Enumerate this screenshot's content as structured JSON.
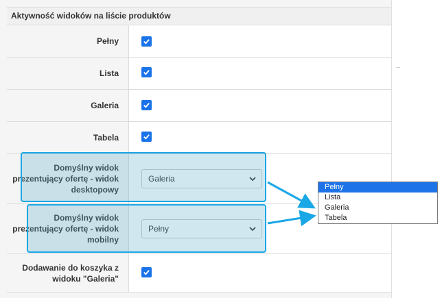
{
  "section": {
    "title": "Aktywność widoków na liście produktów"
  },
  "rows": [
    {
      "label": "Pełny",
      "checked": true
    },
    {
      "label": "Lista",
      "checked": true
    },
    {
      "label": "Galeria",
      "checked": true
    },
    {
      "label": "Tabela",
      "checked": true
    },
    {
      "label": "Domyślny widok prezentujący ofertę - widok desktopowy",
      "select_value": "Galeria"
    },
    {
      "label": "Domyślny widok prezentujący ofertę - widok mobilny",
      "select_value": "Pełny"
    },
    {
      "label": "Dodawanie do koszyka z widoku \"Galeria\"",
      "checked": true
    }
  ],
  "dropdown": {
    "options": [
      "Pełny",
      "Lista",
      "Galeria",
      "Tabela"
    ],
    "selected": "Pełny"
  },
  "colors": {
    "checkbox": "#1a73e8",
    "highlight": "#1aa7e6",
    "selected_option": "#1e73e8"
  },
  "icons": {
    "checkbox": "checkmark-icon",
    "select": "chevron-down-icon",
    "annotation": "arrow-icon"
  }
}
